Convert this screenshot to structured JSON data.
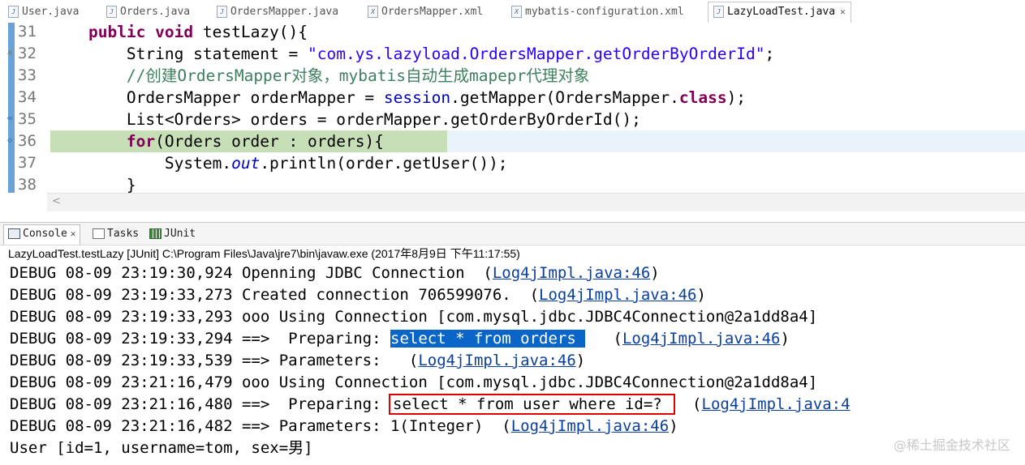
{
  "editor_tabs": [
    {
      "label": "User.java",
      "icon": "java-file-icon"
    },
    {
      "label": "Orders.java",
      "icon": "java-file-icon"
    },
    {
      "label": "OrdersMapper.java",
      "icon": "java-file-icon"
    },
    {
      "label": "OrdersMapper.xml",
      "icon": "xml-file-icon"
    },
    {
      "label": "mybatis-configuration.xml",
      "icon": "xml-file-icon"
    },
    {
      "label": "LazyLoadTest.java",
      "icon": "java-file-icon",
      "active": true
    }
  ],
  "editor": {
    "line_numbers": [
      "31",
      "32",
      "33",
      "34",
      "35",
      "36",
      "37",
      "38"
    ],
    "lines": {
      "l31": {
        "kw1": "public",
        "kw2": "void",
        "rest": " testLazy(){"
      },
      "l32": {
        "pre": "String statement = ",
        "str": "\"com.ys.lazyload.OrdersMapper.getOrderByOrderId\"",
        "post": ";"
      },
      "l33": {
        "comment": "//创建OrdersMapper对象，mybatis自动生成mapepr代理对象"
      },
      "l34": {
        "pre": "OrdersMapper orderMapper = ",
        "field": "session",
        "mid": ".getMapper(OrdersMapper.",
        "kw": "class",
        "post": ");"
      },
      "l35": {
        "text": "List<Orders> orders = orderMapper.getOrderByOrderId();"
      },
      "l36": {
        "kw": "for",
        "rest": "(Orders order : orders){"
      },
      "l37": {
        "pre": "System.",
        "ital": "out",
        "post": ".println(order.getUser());"
      },
      "l38": {
        "text": "}"
      }
    },
    "scroll_arrow": "<"
  },
  "view_tabs": [
    {
      "label": "Console",
      "icon": "console-icon",
      "active": true
    },
    {
      "label": "Tasks",
      "icon": "tasks-icon"
    },
    {
      "label": "JUnit",
      "icon": "junit-icon"
    }
  ],
  "console": {
    "description": "LazyLoadTest.testLazy [JUnit] C:\\Program Files\\Java\\jre7\\bin\\javaw.exe (2017年8月9日 下午11:17:55)",
    "lines": [
      {
        "prefix": "DEBUG 08-09 23:19:30,924 Openning JDBC Connection  (",
        "link": "Log4jImpl.java:46",
        "suffix": ")"
      },
      {
        "prefix": "DEBUG 08-09 23:19:33,273 Created connection 706599076.  (",
        "link": "Log4jImpl.java:46",
        "suffix": ")"
      },
      {
        "prefix": "DEBUG 08-09 23:19:33,293 ooo Using Connection [com.mysql.jdbc.JDBC4Connection@2a1dd8a4]",
        "link": "",
        "suffix": ""
      },
      {
        "prefix": "DEBUG 08-09 23:19:33,294 ==>  Preparing: ",
        "sql": "select * from orders ",
        "mid": "   (",
        "link": "Log4jImpl.java:46",
        "suffix": ")"
      },
      {
        "prefix": "DEBUG 08-09 23:19:33,539 ==> Parameters:   (",
        "link": "Log4jImpl.java:46",
        "suffix": ")"
      },
      {
        "prefix": "DEBUG 08-09 23:21:16,479 ooo Using Connection [com.mysql.jdbc.JDBC4Connection@2a1dd8a4]",
        "link": "",
        "suffix": ""
      },
      {
        "prefix": "DEBUG 08-09 23:21:16,480 ==>  Preparing: ",
        "sql": "select * from user where id=? ",
        "mid": "  (",
        "link": "Log4jImpl.java:4",
        "suffix": ""
      },
      {
        "prefix": "DEBUG 08-09 23:21:16,482 ==> Parameters: 1(Integer)  (",
        "link": "Log4jImpl.java:46",
        "suffix": ")"
      },
      {
        "prefix": "User [id=1, username=tom, sex=男]",
        "link": "",
        "suffix": ""
      }
    ]
  },
  "watermark": "@稀土掘金技术社区",
  "colors": {
    "keyword": "#7f0055",
    "string": "#2a00ff",
    "comment": "#3f7f5f",
    "link": "#0b3f9e",
    "selection": "#0a65c9",
    "highlight_line": "#c7dfb6",
    "annotation_box": "#e00000"
  }
}
